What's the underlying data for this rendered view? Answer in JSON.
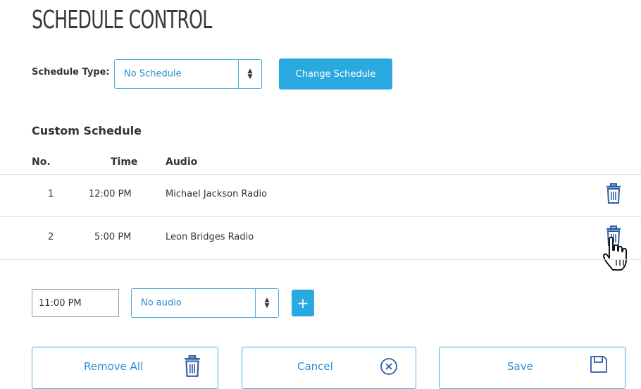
{
  "page": {
    "title": "SCHEDULE CONTROL"
  },
  "schedule_type": {
    "label": "Schedule Type:",
    "selected": "No Schedule",
    "change_button": "Change Schedule"
  },
  "custom_schedule": {
    "heading": "Custom Schedule",
    "columns": [
      "No.",
      "Time",
      "Audio"
    ],
    "rows": [
      {
        "no": "1",
        "time": "12:00 PM",
        "audio": "Michael Jackson Radio"
      },
      {
        "no": "2",
        "time": "5:00 PM",
        "audio": "Leon Bridges Radio"
      }
    ]
  },
  "new_entry": {
    "time_value": "11:00 PM",
    "audio_selected": "No audio",
    "add_label": "+"
  },
  "actions": {
    "remove_all": "Remove All",
    "cancel": "Cancel",
    "save": "Save"
  },
  "colors": {
    "accent": "#2aa9e0",
    "icon": "#2a5ea8",
    "border": "#4aaee0"
  }
}
